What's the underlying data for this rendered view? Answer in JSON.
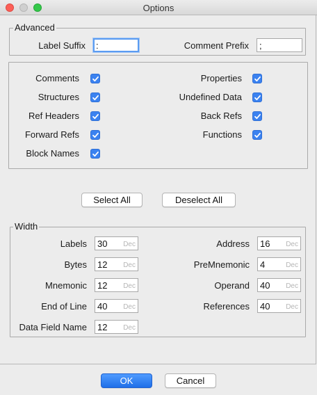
{
  "window": {
    "title": "Options"
  },
  "advanced": {
    "legend": "Advanced",
    "label_suffix_label": "Label Suffix",
    "label_suffix_value": ":",
    "comment_prefix_label": "Comment Prefix",
    "comment_prefix_value": ";"
  },
  "options": {
    "left": [
      {
        "label": "Comments",
        "checked": true
      },
      {
        "label": "Structures",
        "checked": true
      },
      {
        "label": "Ref Headers",
        "checked": true
      },
      {
        "label": "Forward Refs",
        "checked": true
      },
      {
        "label": "Block Names",
        "checked": true
      }
    ],
    "right": [
      {
        "label": "Properties",
        "checked": true
      },
      {
        "label": "Undefined Data",
        "checked": true
      },
      {
        "label": "Back Refs",
        "checked": true
      },
      {
        "label": "Functions",
        "checked": true
      }
    ]
  },
  "buttons": {
    "select_all": "Select All",
    "deselect_all": "Deselect All",
    "ok": "OK",
    "cancel": "Cancel"
  },
  "width": {
    "legend": "Width",
    "unit": "Dec",
    "left": [
      {
        "label": "Labels",
        "value": "30"
      },
      {
        "label": "Bytes",
        "value": "12"
      },
      {
        "label": "Mnemonic",
        "value": "12"
      },
      {
        "label": "End of Line",
        "value": "40"
      },
      {
        "label": "Data Field Name",
        "value": "12"
      }
    ],
    "right": [
      {
        "label": "Address",
        "value": "16"
      },
      {
        "label": "PreMnemonic",
        "value": "4"
      },
      {
        "label": "Operand",
        "value": "40"
      },
      {
        "label": "References",
        "value": "40"
      }
    ]
  },
  "colors": {
    "accent": "#3b82f0",
    "focus_ring": "#5b9cf1"
  },
  "icons": {
    "checkbox": "check-icon"
  }
}
